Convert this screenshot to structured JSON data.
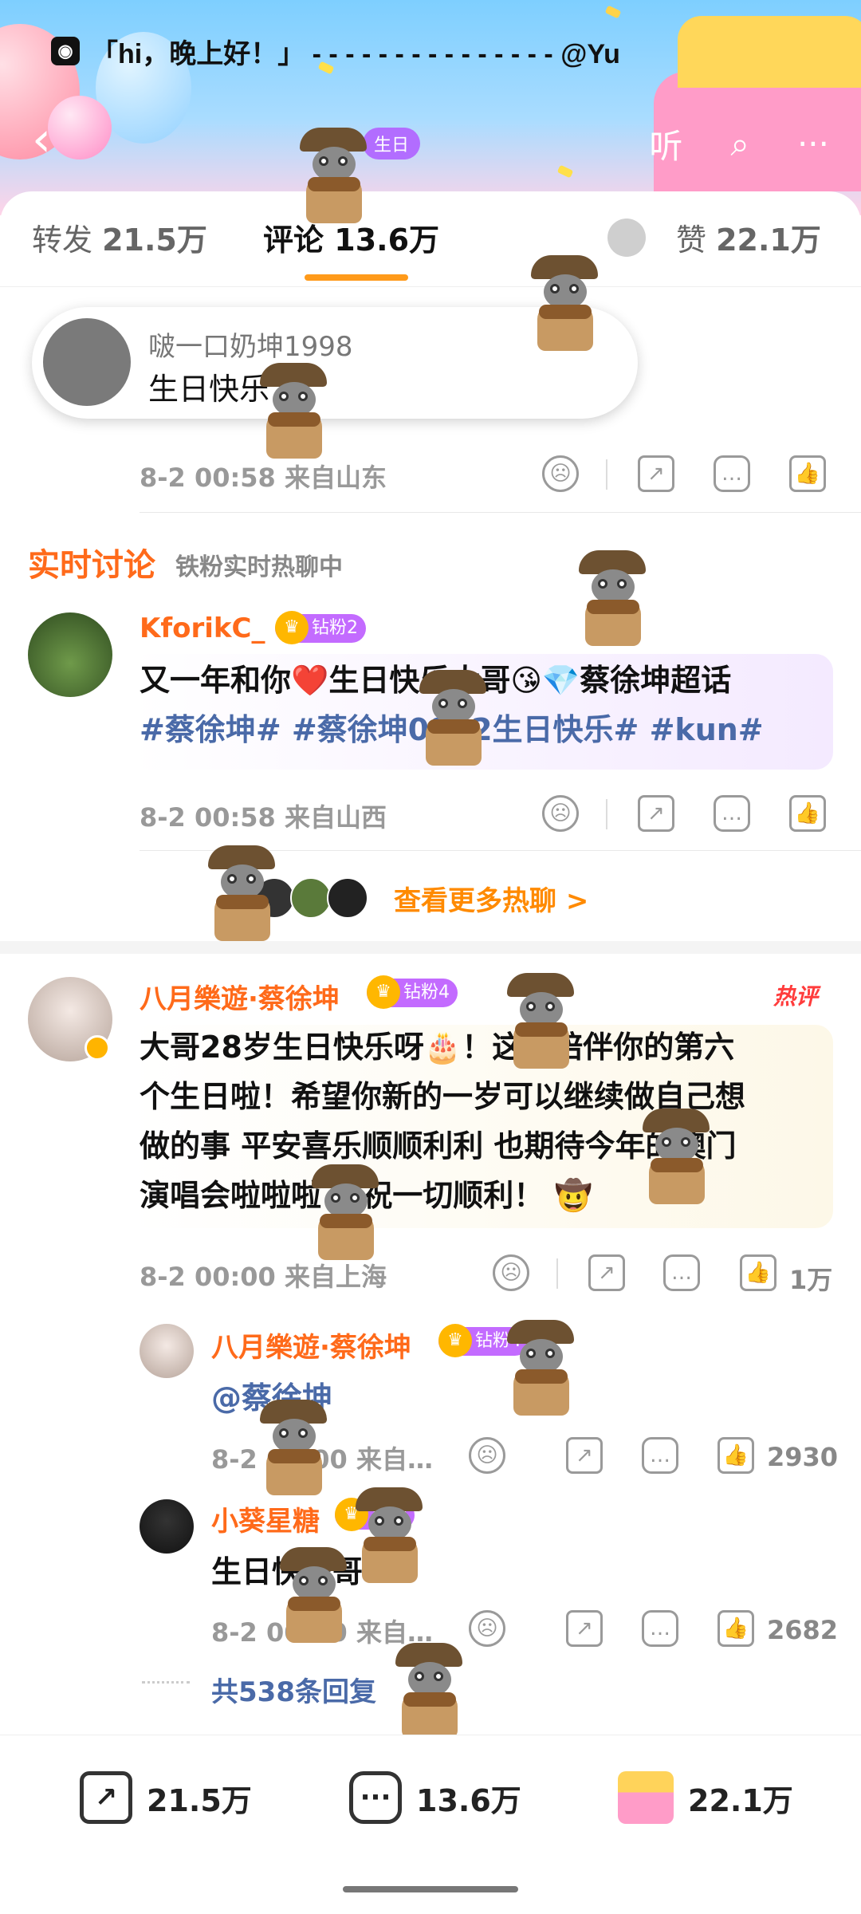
{
  "status": {
    "title": "「hi，晚上好！」 - - - -                   - - - - - - - - - - - @Yu"
  },
  "header": {
    "back_icon": "back-chevron-icon",
    "birthday_chip": "生日",
    "listen_label": "听",
    "search_icon": "search-icon",
    "more_icon": "more-dots-icon"
  },
  "tabs": [
    {
      "label": "转发",
      "count": "21.5万"
    },
    {
      "label": "评论",
      "count": "13.6万"
    },
    {
      "label": "赞",
      "count": "22.1万"
    }
  ],
  "toast": {
    "name": "啵一口奶坤1998",
    "text": "生日快乐"
  },
  "first_comment_meta": {
    "time": "8-2 00:58",
    "location": "来自山东"
  },
  "live": {
    "title": "实时讨论",
    "subtitle": "铁粉实时热聊中"
  },
  "comments": [
    {
      "name": "KforikC_",
      "badge": "钻粉2",
      "text_line1": "又一年和你❤️生日快乐大哥😘💎蔡徐坤超话",
      "text_line2": "#蔡徐坤# #蔡徐坤0802生日快乐# #kun#",
      "time": "8-2 00:58",
      "location": "来自山西"
    },
    {
      "name": "八月樂遊·蔡徐坤",
      "badge": "钻粉4",
      "hot": "热评",
      "text_lines": [
        "大哥28岁生日快乐呀🎂！这是陪伴你的第六",
        "个生日啦！希望你新的一岁可以继续做自己想",
        "做的事 平安喜乐顺顺利利 也期待今年的澳门",
        "演唱会啦啦啦 预祝一切顺利！ 🤠"
      ],
      "time": "8-2 00:00",
      "location": "来自上海",
      "likes": "1万"
    }
  ],
  "more_hot": {
    "label": "查看更多热聊 >"
  },
  "replies": [
    {
      "name": "八月樂遊·蔡徐坤",
      "badge": "钻粉4",
      "text": "@蔡徐坤",
      "time": "8-2 00:00",
      "location": "来自…",
      "likes": "2930"
    },
    {
      "name": "小葵星糖",
      "badge": "钻粉",
      "text": "生日快乐哥",
      "time": "8-2 00:00",
      "location": "来自…",
      "likes": "2682"
    }
  ],
  "total_replies": "共538条回复",
  "bottom_bar": {
    "repost_count": "21.5万",
    "comment_count": "13.6万",
    "like_count": "22.1万"
  },
  "colors": {
    "accent_orange": "#ff6a1a",
    "topic_blue": "#4a6aa8",
    "badge_purple": "#c36bff",
    "tab_indicator": "#ff9a1a"
  }
}
